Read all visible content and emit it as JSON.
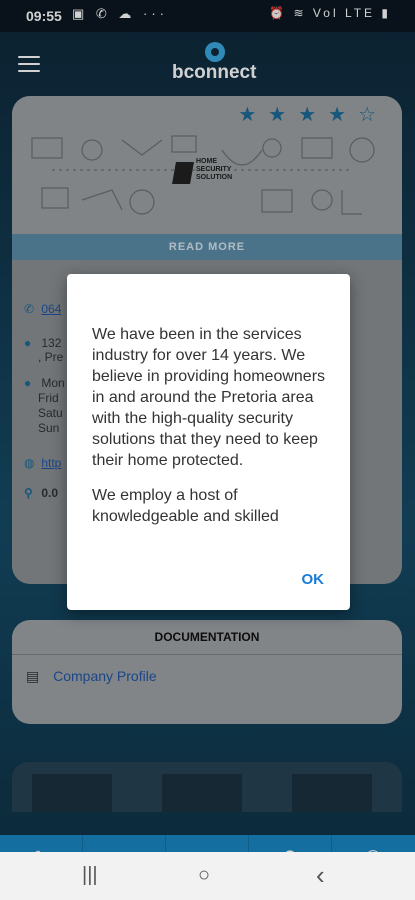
{
  "status_bar": {
    "time": "09:55",
    "left_icons": "▣ ✆ ☁ ···",
    "right_icons": "⏰ ≋ Vol LTE ▮"
  },
  "app": {
    "brand": "bconnect"
  },
  "business": {
    "rating": 4,
    "max_rating": 5,
    "logo_lines": [
      "HOME",
      "SECURITY",
      "SOLUTION"
    ],
    "read_more": "READ MORE",
    "phone_partial": "064",
    "address_partial": [
      "132",
      ", Pre"
    ],
    "hours_partial": [
      "Mon",
      "Frid",
      "Satu",
      "Sun"
    ],
    "website_partial": "http",
    "rating_partial": "0.0"
  },
  "documentation": {
    "title": "DOCUMENTATION",
    "items": [
      {
        "label": "Company Profile",
        "icon": "document-icon"
      }
    ]
  },
  "dialog": {
    "paragraphs": [
      "We have been in the services industry for over 14 years. We believe in providing homeowners in and around the Pretoria area with the high-quality security solutions that they need to keep their home protected.",
      "We employ a host of knowledgeable and skilled"
    ],
    "ok_label": "OK"
  },
  "bottom_nav": [
    {
      "icon": "edit-icon",
      "glyph": "✎"
    },
    {
      "icon": "profile-icon",
      "glyph": "●"
    },
    {
      "icon": "home-icon",
      "glyph": "⌂"
    },
    {
      "icon": "location-pin-icon",
      "glyph": "⚲"
    },
    {
      "icon": "phone-icon",
      "glyph": "✆"
    }
  ],
  "system_nav": {
    "recents": "|||",
    "home": "○",
    "back": "‹"
  },
  "colors": {
    "accent": "#1a87c4",
    "dialog_button": "#1b7bd6",
    "link": "#2056a8"
  }
}
